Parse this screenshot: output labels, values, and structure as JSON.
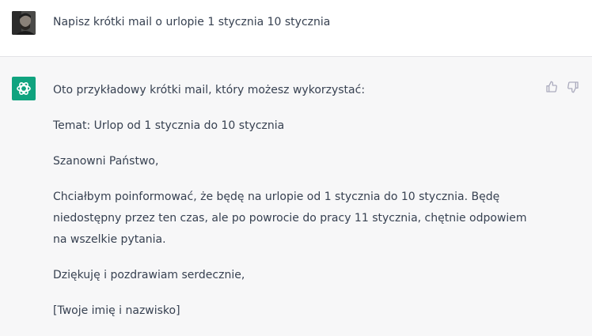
{
  "user_message": "Napisz krótki mail o urlopie 1 stycznia 10 stycznia",
  "assistant": {
    "intro": "Oto przykładowy krótki mail, który możesz wykorzystać:",
    "subject": "Temat: Urlop od 1 stycznia do 10 stycznia",
    "greeting": "Szanowni Państwo,",
    "body": "Chciałbym poinformować, że będę na urlopie od 1 stycznia do 10 stycznia. Będę niedostępny przez ten czas, ale po powrocie do pracy 11 stycznia, chętnie odpowiem na wszelkie pytania.",
    "closing": "Dziękuję i pozdrawiam serdecznie,",
    "signature": "[Twoje imię i nazwisko]"
  },
  "icons": {
    "user_avatar": "user-avatar",
    "assistant_avatar": "openai-logo-icon",
    "thumb_up": "thumbs-up-icon",
    "thumb_down": "thumbs-down-icon"
  },
  "colors": {
    "assistant_accent": "#10a37f",
    "user_bg": "#ffffff",
    "assistant_bg": "#f7f7f8",
    "text": "#374151",
    "icon": "#acacbe"
  }
}
